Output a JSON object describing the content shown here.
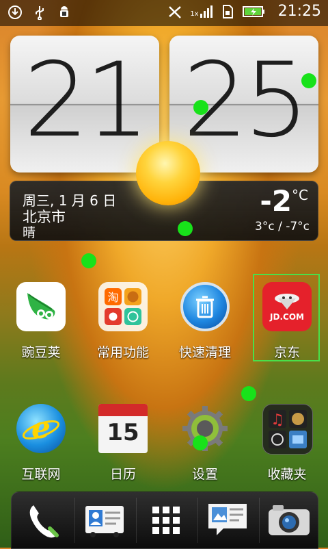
{
  "status_bar": {
    "time": "21:25",
    "network": "1x"
  },
  "clock": {
    "hours": "21",
    "minutes": "25"
  },
  "weather": {
    "date": "周三, 1 月 6 日",
    "city": "北京市",
    "condition": "晴",
    "temp": "-2",
    "temp_unit": "°C",
    "range": "3°c / -7°c"
  },
  "apps_row1": [
    {
      "label": "豌豆荚",
      "icon": "wandoujia-icon"
    },
    {
      "label": "常用功能",
      "icon": "folder-icon"
    },
    {
      "label": "快速清理",
      "icon": "trash-icon"
    },
    {
      "label": "京东",
      "icon": "jd-icon",
      "icon_text": "JD.COM"
    }
  ],
  "apps_row2": [
    {
      "label": "互联网",
      "icon": "browser-icon"
    },
    {
      "label": "日历",
      "icon": "calendar-icon",
      "icon_text": "15"
    },
    {
      "label": "设置",
      "icon": "gear-icon"
    },
    {
      "label": "收藏夹",
      "icon": "favorites-folder-icon"
    }
  ],
  "folder_mini_labels": {
    "taobao": "淘"
  },
  "dock": [
    {
      "name": "phone-icon"
    },
    {
      "name": "contacts-icon"
    },
    {
      "name": "all-apps-icon"
    },
    {
      "name": "messages-icon"
    },
    {
      "name": "camera-icon"
    }
  ],
  "colors": {
    "accent_green": "#18e21a",
    "jd_red": "#e5212b",
    "highlight_green": "#49e04a"
  }
}
